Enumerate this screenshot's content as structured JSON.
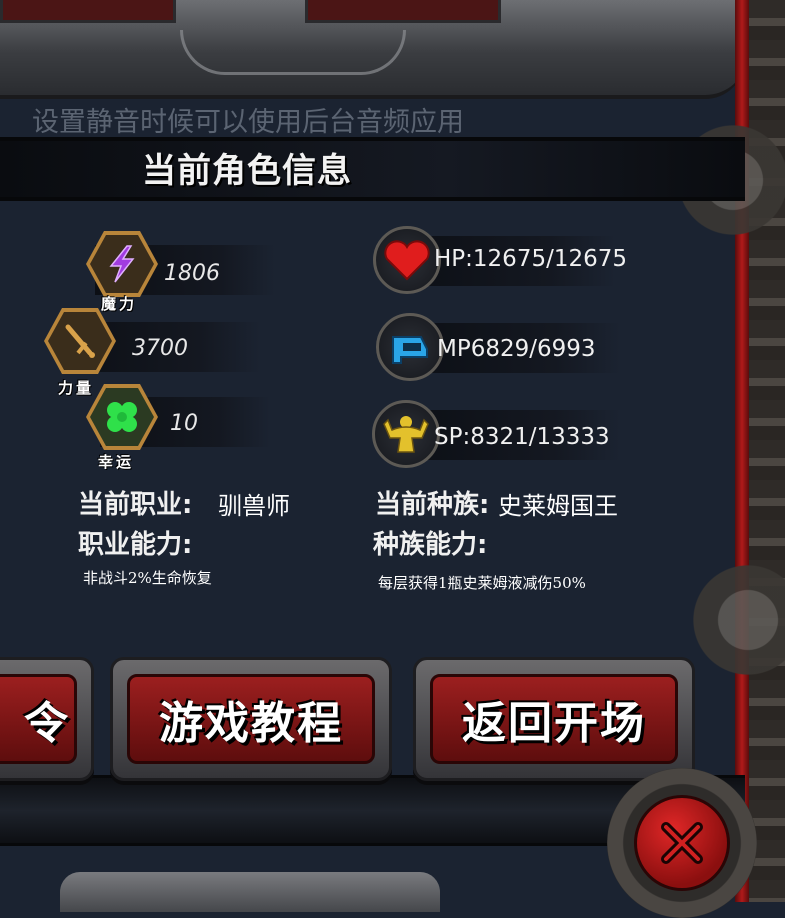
{
  "hint": {
    "mute_text": "设置静音时候可以使用后台音频应用"
  },
  "panel": {
    "title": "当前角色信息"
  },
  "attributes": [
    {
      "name": "魔力",
      "value": "1806",
      "icon": "lightning-icon"
    },
    {
      "name": "力量",
      "value": "3700",
      "icon": "sword-icon"
    },
    {
      "name": "幸运",
      "value": "10",
      "icon": "clover-icon"
    }
  ],
  "resources": [
    {
      "icon": "heart-icon",
      "text": "HP:12675/12675"
    },
    {
      "icon": "mana-icon",
      "text": "MP6829/6993"
    },
    {
      "icon": "muscle-icon",
      "text": "SP:8321/13333"
    }
  ],
  "profession": {
    "label": "当前职业:",
    "value": "驯兽师",
    "ability_label": "职业能力:",
    "ability_text": "非战斗2%生命恢复"
  },
  "race": {
    "label": "当前种族:",
    "value": "史莱姆国王",
    "ability_label": "种族能力:",
    "ability_text": "每层获得1瓶史莱姆液减伤50%"
  },
  "buttons": {
    "partial_label": "令",
    "tutorial_label": "游戏教程",
    "return_label": "返回开场"
  },
  "colors": {
    "background": "#1b2331",
    "button_red": "#9c1f1f",
    "attribute_frame": "#b8853a"
  }
}
